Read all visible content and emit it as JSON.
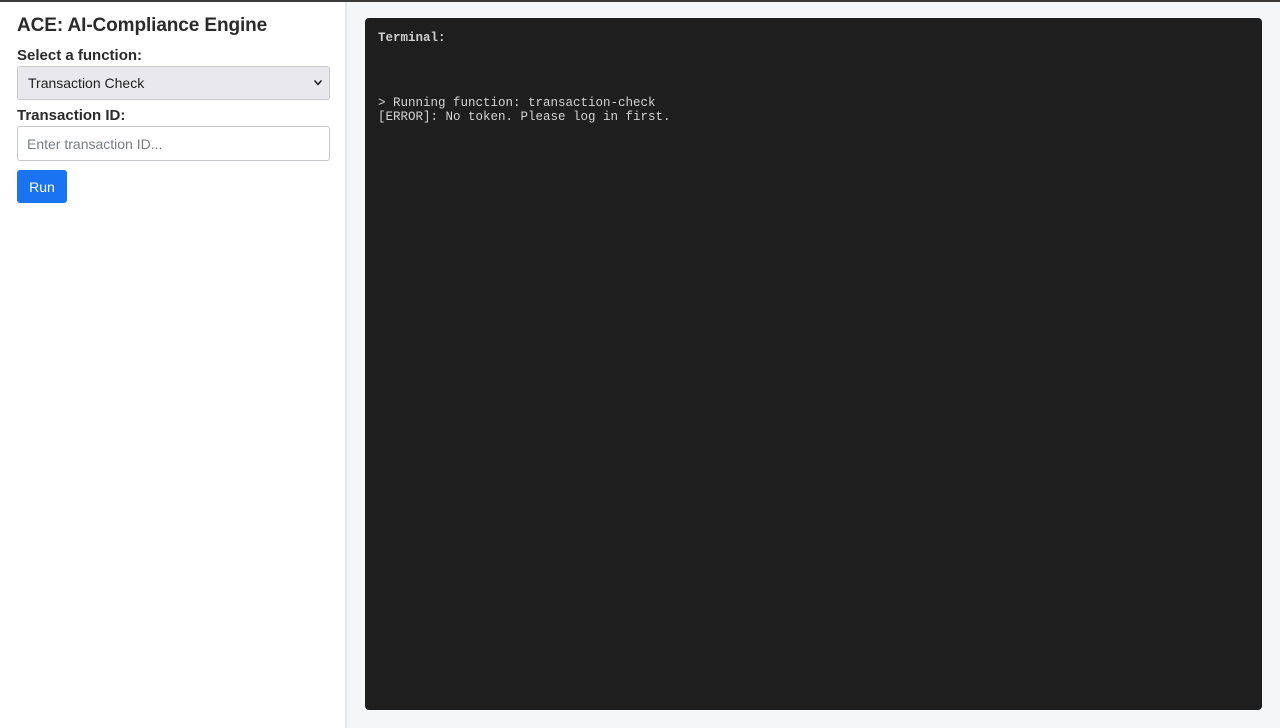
{
  "app": {
    "title": "ACE: AI-Compliance Engine"
  },
  "form": {
    "function_label": "Select a function:",
    "function_selected": "Transaction Check",
    "transaction_label": "Transaction ID:",
    "transaction_value": "",
    "transaction_placeholder": "Enter transaction ID...",
    "run_label": "Run"
  },
  "terminal": {
    "header": "Terminal:",
    "lines": [
      "> Running function: transaction-check",
      "[ERROR]: No token. Please log in first."
    ]
  },
  "icons": {
    "select_arrow": "chevron-down-icon"
  },
  "colors": {
    "accent": "#1a73f0",
    "terminal_bg": "#1e1e1e",
    "terminal_text": "#d4d4d4"
  }
}
